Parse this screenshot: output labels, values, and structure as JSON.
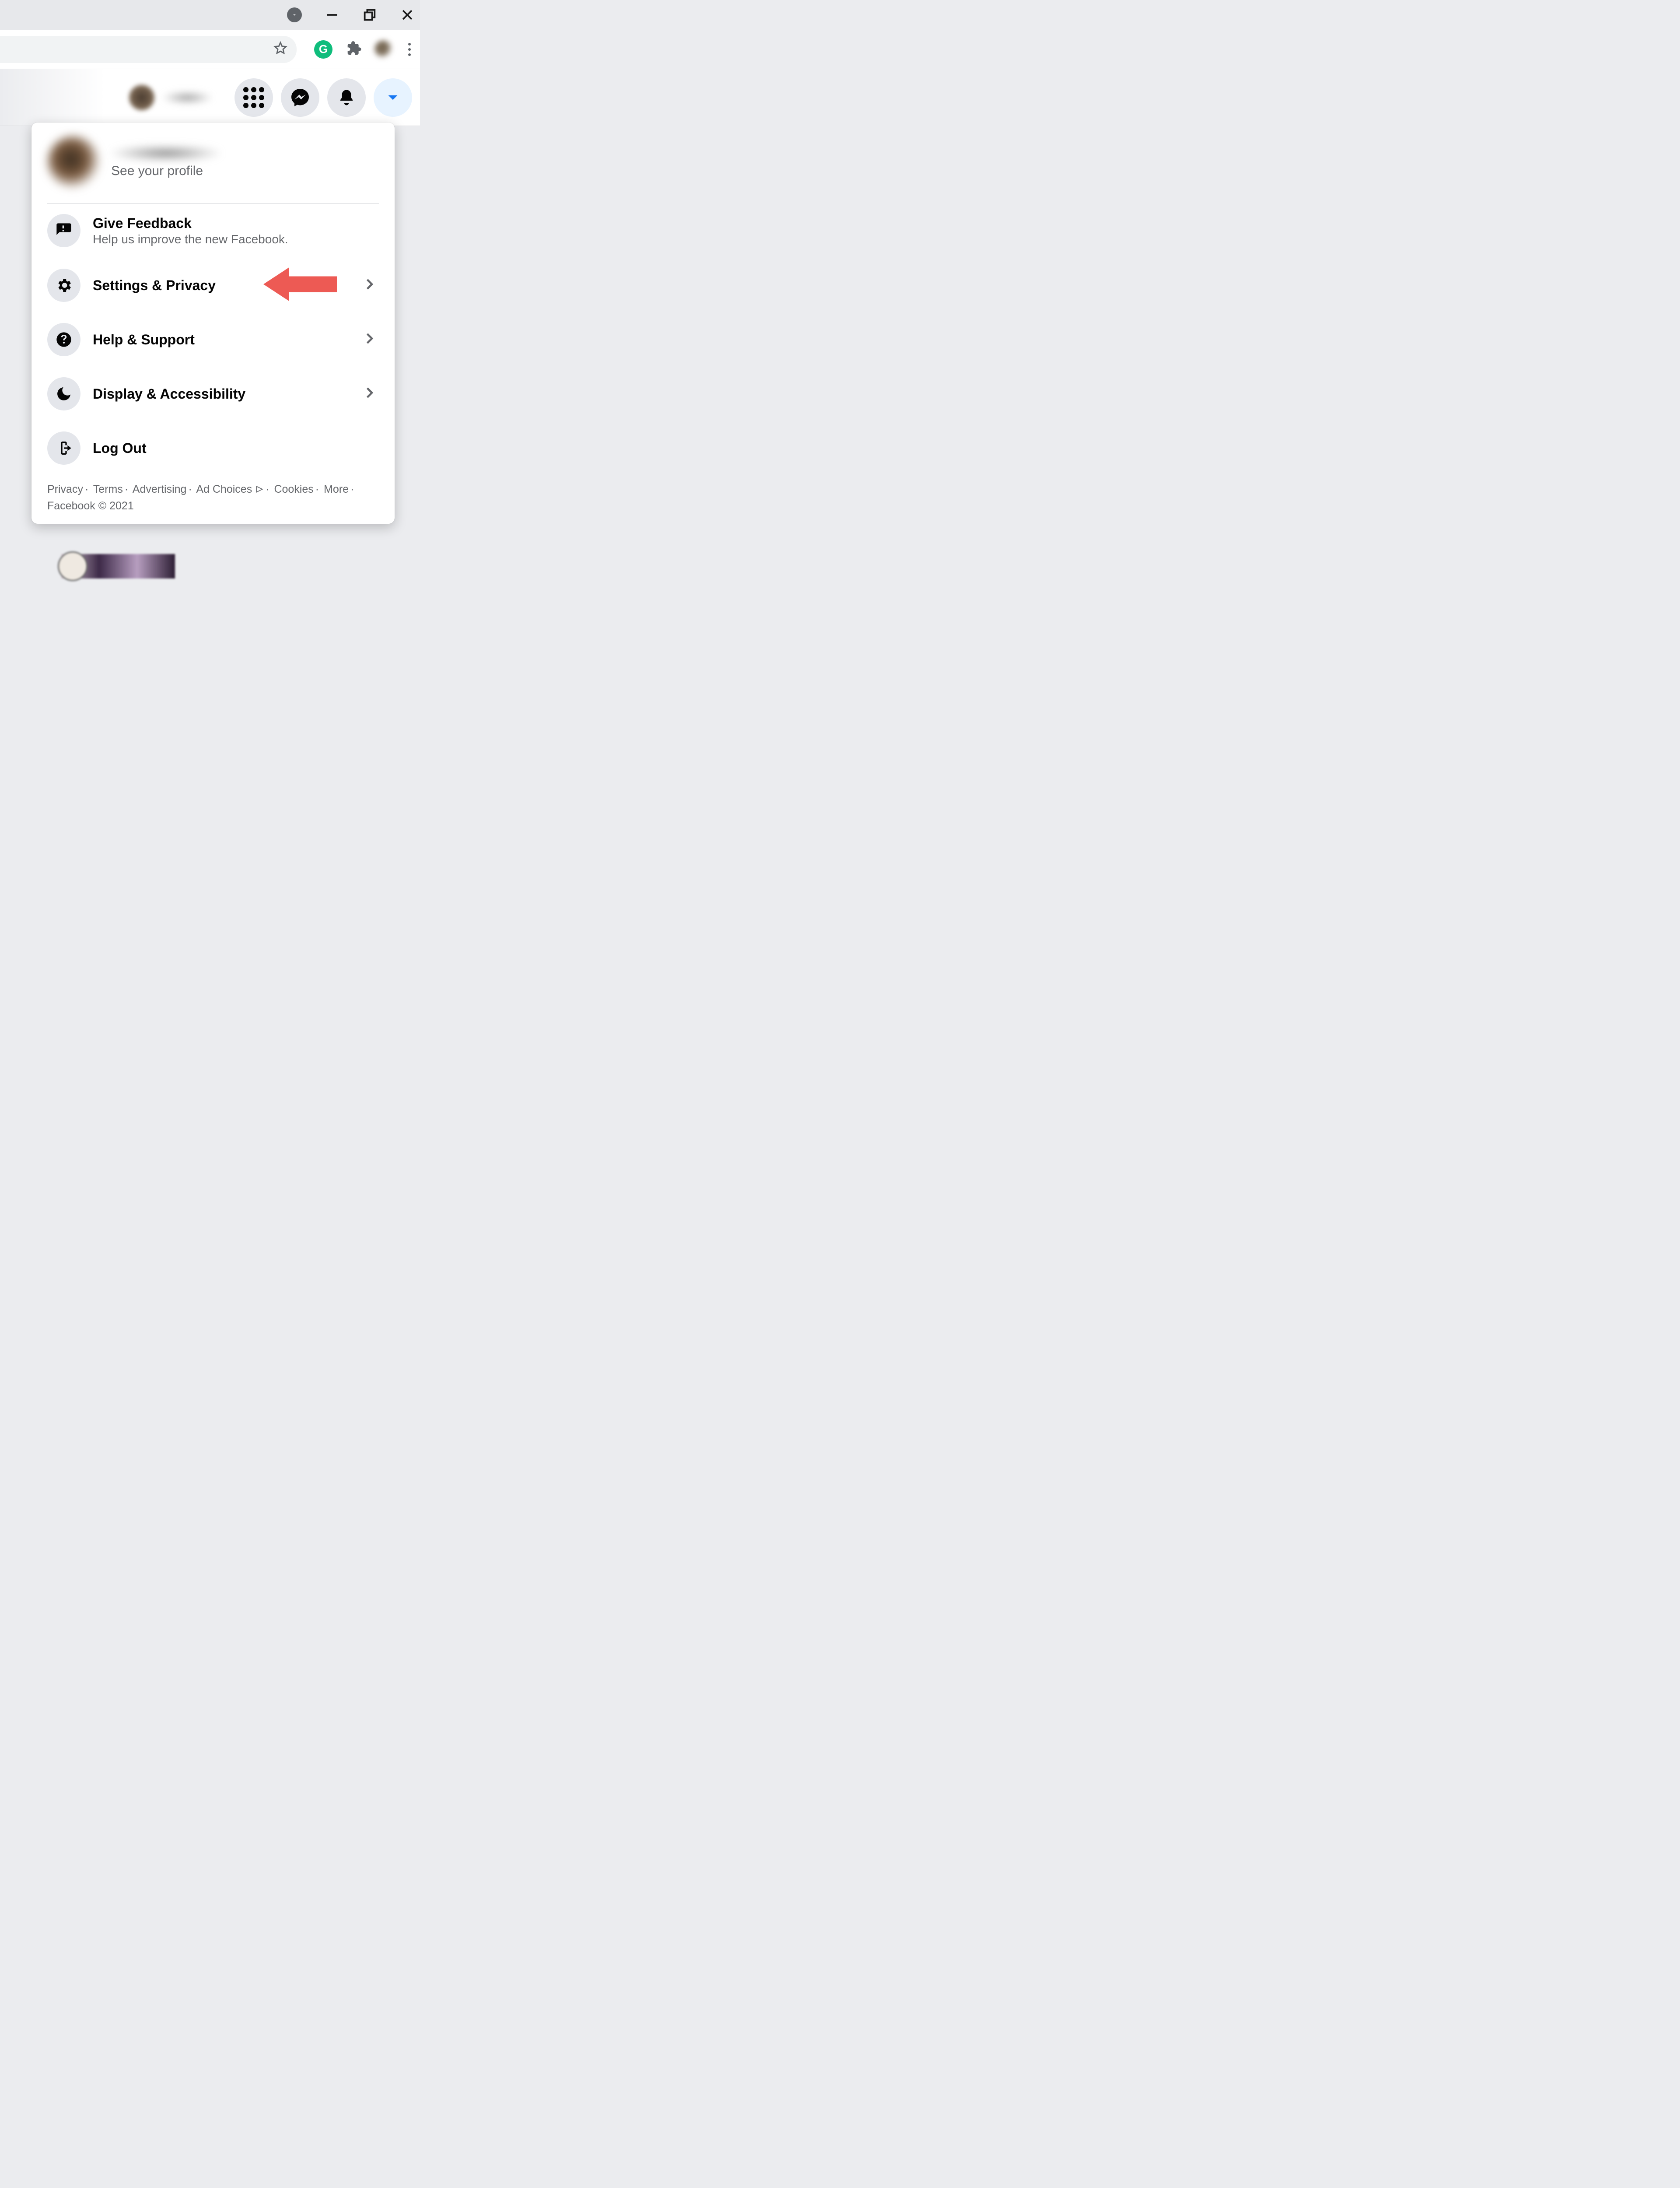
{
  "dropdown": {
    "profile_sub": "See your profile",
    "feedback": {
      "title": "Give Feedback",
      "desc": "Help us improve the new Facebook."
    },
    "items": [
      {
        "label": "Settings & Privacy"
      },
      {
        "label": "Help & Support"
      },
      {
        "label": "Display & Accessibility"
      },
      {
        "label": "Log Out"
      }
    ],
    "footer": {
      "links": [
        "Privacy",
        "Terms",
        "Advertising",
        "Ad Choices",
        "Cookies",
        "More"
      ],
      "copyright": "Facebook © 2021"
    }
  },
  "ext_g_label": "G"
}
